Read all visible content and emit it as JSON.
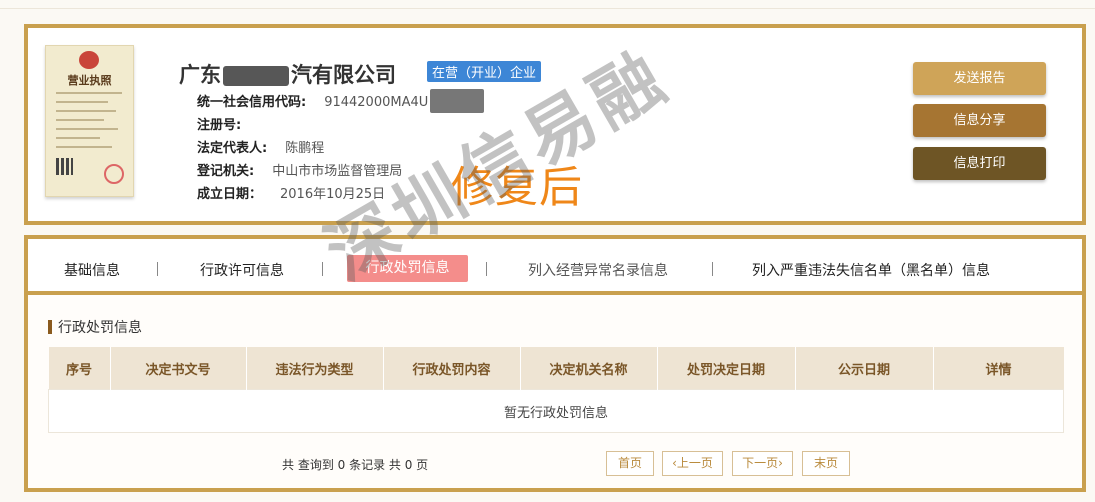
{
  "company": {
    "name_prefix": "广东",
    "name_suffix": "汽有限公司",
    "status": "在营（开业）企业",
    "fields": [
      {
        "label": "统一社会信用代码:",
        "value": "91442000MA4U"
      },
      {
        "label": "注册号:",
        "value": ""
      },
      {
        "label": "法定代表人:",
        "value": "陈鹏程"
      },
      {
        "label": "登记机关:",
        "value": "中山市市场监督管理局"
      },
      {
        "label": "成立日期：",
        "value": "2016年10月25日"
      }
    ],
    "license_title": "营业执照"
  },
  "overlay": {
    "repaired_text": "修复后",
    "watermark": "深圳信易融"
  },
  "actions": {
    "send_report": "发送报告",
    "share": "信息分享",
    "print": "信息打印"
  },
  "tabs": [
    {
      "label": "基础信息"
    },
    {
      "label": "行政许可信息"
    },
    {
      "label": "行政处罚信息"
    },
    {
      "label": "列入经营异常名录信息"
    },
    {
      "label": "列入严重违法失信名单（黑名单）信息"
    }
  ],
  "section": {
    "title": "行政处罚信息",
    "columns": [
      "序号",
      "决定书文号",
      "违法行为类型",
      "行政处罚内容",
      "决定机关名称",
      "处罚决定日期",
      "公示日期",
      "详情"
    ],
    "empty_text": "暂无行政处罚信息"
  },
  "pagination": {
    "summary": "共 查询到 0 条记录 共 0 页",
    "first": "首页",
    "prev": "上一页",
    "next": "下一页",
    "last": "末页"
  },
  "colors": {
    "border_gold": "#c9a04e",
    "tab_active_bg": "#f48d8b",
    "status_blue": "#3d86d6",
    "repaired_orange": "#ef8719"
  }
}
